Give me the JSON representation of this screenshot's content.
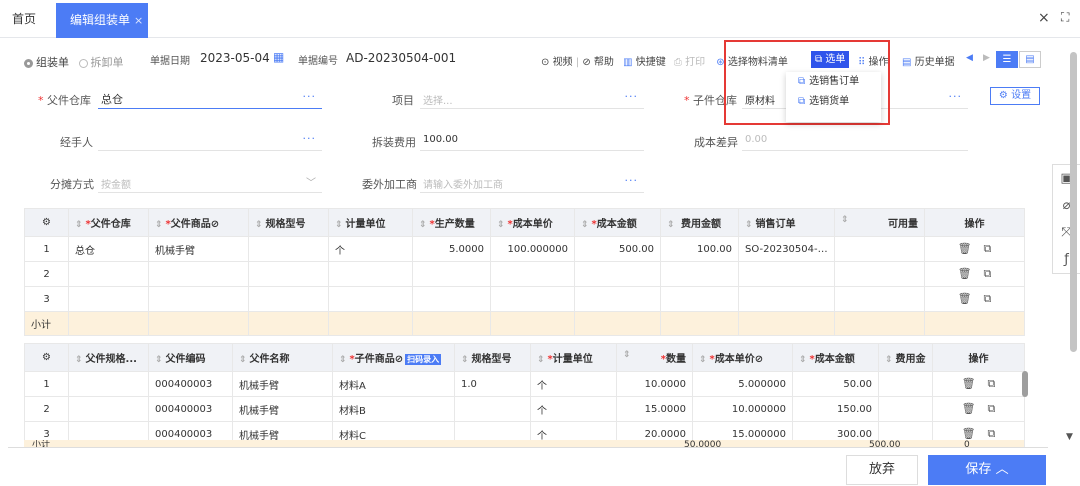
{
  "tabs": {
    "home": "首页",
    "active": "编辑组装单",
    "active_close": "×"
  },
  "window": {
    "close": "×",
    "expand": "⛶"
  },
  "mode": {
    "assemble": "组装单",
    "disassemble": "拆卸单"
  },
  "header": {
    "date_label": "单据日期",
    "date_value": "2023-05-04",
    "number_label": "单据编号",
    "number_value": "AD-20230504-001"
  },
  "toolbar": {
    "video": "视频",
    "help": "帮助",
    "shortcut": "快捷键",
    "print": "打印",
    "select_material": "选择物料清单",
    "select_order": "选单",
    "operation": "操作",
    "history": "历史单据"
  },
  "dropdown": {
    "item1": "选销售订单",
    "item2": "选销货单"
  },
  "form": {
    "parent_wh_label": "父件仓库",
    "parent_wh_value": "总仓",
    "project_label": "项目",
    "project_placeholder": "选择...",
    "child_wh_label": "子件仓库",
    "child_wh_value": "原材料",
    "settings": "设置",
    "handler_label": "经手人",
    "fee_label": "拆装费用",
    "fee_value": "100.00",
    "diff_label": "成本差异",
    "diff_value": "0.00",
    "alloc_label": "分摊方式",
    "alloc_placeholder": "按金额",
    "outsource_label": "委外加工商",
    "outsource_placeholder": "请输入委外加工商"
  },
  "table1": {
    "headers": [
      "父件仓库",
      "父件商品",
      "规格型号",
      "计量单位",
      "生产数量",
      "成本单价",
      "成本金额",
      "费用金额",
      "销售订单",
      "可用量",
      "操作"
    ],
    "rows": [
      {
        "idx": "1",
        "wh": "总仓",
        "item": "机械手臂",
        "spec": "",
        "unit": "个",
        "qty": "5.0000",
        "price": "100.000000",
        "amount": "500.00",
        "fee": "100.00",
        "order": "SO-20230504-0..."
      },
      {
        "idx": "2",
        "wh": "",
        "item": "",
        "spec": "",
        "unit": "",
        "qty": "",
        "price": "",
        "amount": "",
        "fee": "",
        "order": ""
      },
      {
        "idx": "3",
        "wh": "",
        "item": "",
        "spec": "",
        "unit": "",
        "qty": "",
        "price": "",
        "amount": "",
        "fee": "",
        "order": ""
      }
    ],
    "subtotal": "小计"
  },
  "table2": {
    "headers": [
      "父件规格...",
      "父件编码",
      "父件名称",
      "子件商品",
      "规格型号",
      "计量单位",
      "数量",
      "成本单价",
      "成本金额",
      "费用金",
      "操作"
    ],
    "scan_badge": "扫码录入",
    "rows": [
      {
        "idx": "1",
        "pcode": "000400003",
        "pname": "机械手臂",
        "child": "材料A",
        "spec": "1.0",
        "unit": "个",
        "qty": "10.0000",
        "price": "5.000000",
        "amount": "50.00"
      },
      {
        "idx": "2",
        "pcode": "000400003",
        "pname": "机械手臂",
        "child": "材料B",
        "spec": "",
        "unit": "个",
        "qty": "15.0000",
        "price": "10.000000",
        "amount": "150.00"
      },
      {
        "idx": "3",
        "pcode": "000400003",
        "pname": "机械手臂",
        "child": "材料C",
        "spec": "",
        "unit": "个",
        "qty": "20.0000",
        "price": "15.000000",
        "amount": "300.00"
      }
    ],
    "subtotal": "小计",
    "subtotal_qty": "50.0000",
    "subtotal_amount": "500.00",
    "subtotal_fee": "0"
  },
  "footer": {
    "cancel": "放弃",
    "save": "保存"
  }
}
